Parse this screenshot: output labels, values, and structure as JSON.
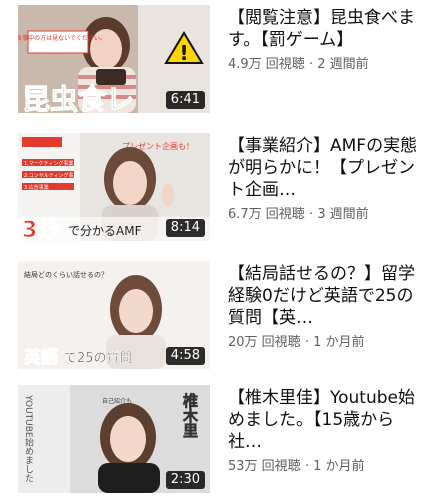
{
  "videos": [
    {
      "title": "【閲覧注意】昆虫食べます。【罰ゲーム】",
      "views": "4.9万 回視聴",
      "age": "2 週間前",
      "duration": "6:41",
      "thumb": {
        "overlay_text": "昆虫食レ",
        "note": "お食事中の方は見ないでください。",
        "warning": "!",
        "bg": "#c9b9ad",
        "caption_color": "#39d04a"
      }
    },
    {
      "title": "【事業紹介】AMFの実態が明らかに！【プレゼント企画…",
      "views": "6.7万 回視聴",
      "age": "3 週間前",
      "duration": "8:14",
      "thumb": {
        "overlay_text": "3分",
        "sub_text": "で分かるAMF",
        "promo": "プレゼント企画も！",
        "bullets": [
          "1.マーケティング事業",
          "2.コンサルティング事業",
          "3.広告事業"
        ],
        "bg": "#e8e4e0",
        "accent": "#e23b2e"
      }
    },
    {
      "title": "【結局話せるの？】留学経験0だけど英語で25の質問【英…",
      "views": "20万 回視聴",
      "age": "1 か月前",
      "duration": "4:58",
      "thumb": {
        "overlay_text": "英語",
        "sub_text": "で25の質問",
        "question": "結局どのくらい話せるの？",
        "bg": "#f4f1ef",
        "caption_color": "#3fd15b"
      }
    },
    {
      "title": "【椎木里佳】Youtube始めました。【15歳から社…",
      "views": "53万 回視聴",
      "age": "1 か月前",
      "duration": "2:30",
      "thumb": {
        "vertical_left": "YOUTUBE始めました",
        "vertical_right": "椎木里",
        "intro": "自己紹介も",
        "bg": "#dcdcdc"
      }
    }
  ],
  "separator": "·"
}
